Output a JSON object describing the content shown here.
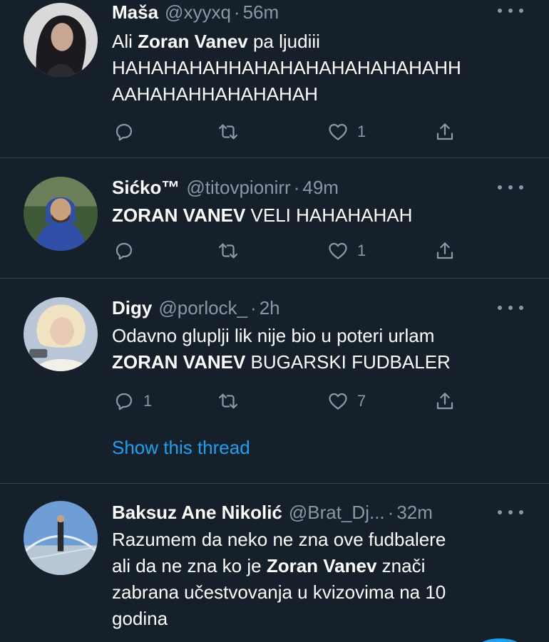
{
  "tweets": [
    {
      "name": "Maša",
      "handle": "@xyyxq",
      "time": "56m",
      "text_before": "Ali ",
      "text_bold": "Zoran Vanev",
      "text_after": " pa ljudiii\nHAHAHAHAHHAHAHAHAHAHAHAHAHH\nAAHAHAHHAHAHAHAH",
      "replies": "",
      "retweets": "",
      "likes": "1"
    },
    {
      "name": "Sićko™",
      "handle": "@titovpionirr",
      "time": "49m",
      "text_before": "",
      "text_bold": "ZORAN VANEV",
      "text_after": " VELI HAHAHAHAH",
      "replies": "",
      "retweets": "",
      "likes": "1"
    },
    {
      "name": "Digy",
      "handle": "@porlock_",
      "time": "2h",
      "text_before": "Odavno gluplji lik nije bio u poteri urlam\n",
      "text_bold": "ZORAN VANEV",
      "text_after": " BUGARSKI FUDBALER",
      "replies": "1",
      "retweets": "",
      "likes": "7",
      "thread_link": "Show this thread"
    },
    {
      "name": "Baksuz Ane Nikolić",
      "handle": "@Brat_Dj...",
      "time": "32m",
      "text_before": "Razumem da neko ne zna ove fudbalere\nali da ne zna ko je ",
      "text_bold": "Zoran Vanev",
      "text_after": " znači\nzabrana učestvovanja u kvizovima na 10\ngodina"
    }
  ],
  "separator": "·",
  "colors": {
    "background": "#15202b",
    "secondary_text": "#8899a6",
    "link": "#1da1f2",
    "divider": "#38444d"
  },
  "icons": {
    "reply": "reply-icon",
    "retweet": "retweet-icon",
    "like": "heart-icon",
    "share": "share-icon",
    "more": "more-icon"
  }
}
